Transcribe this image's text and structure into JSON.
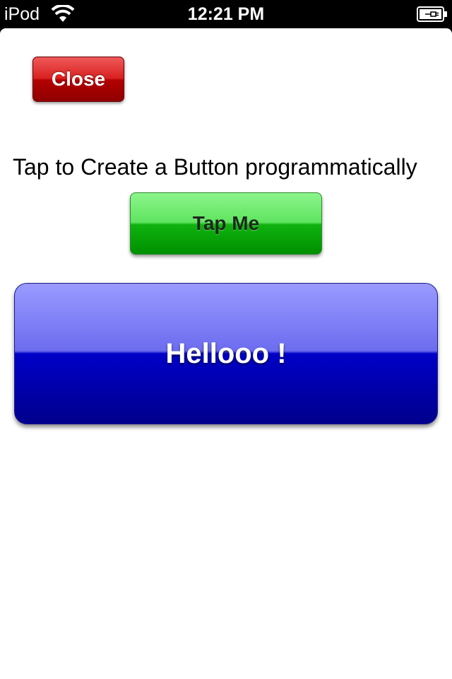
{
  "status_bar": {
    "carrier": "iPod",
    "time": "12:21 PM",
    "wifi_icon": "wifi-icon",
    "battery_icon": "battery-charging-icon"
  },
  "main": {
    "close_button_label": "Close",
    "instruction_text": "Tap to Create a Button programmatically",
    "tap_me_button_label": "Tap Me",
    "hello_button_label": "Hellooo !"
  },
  "colors": {
    "close_button": "#c00000",
    "tap_me_button": "#00b000",
    "hello_button": "#0000c0",
    "background": "#ffffff",
    "status_bar": "#000000"
  }
}
